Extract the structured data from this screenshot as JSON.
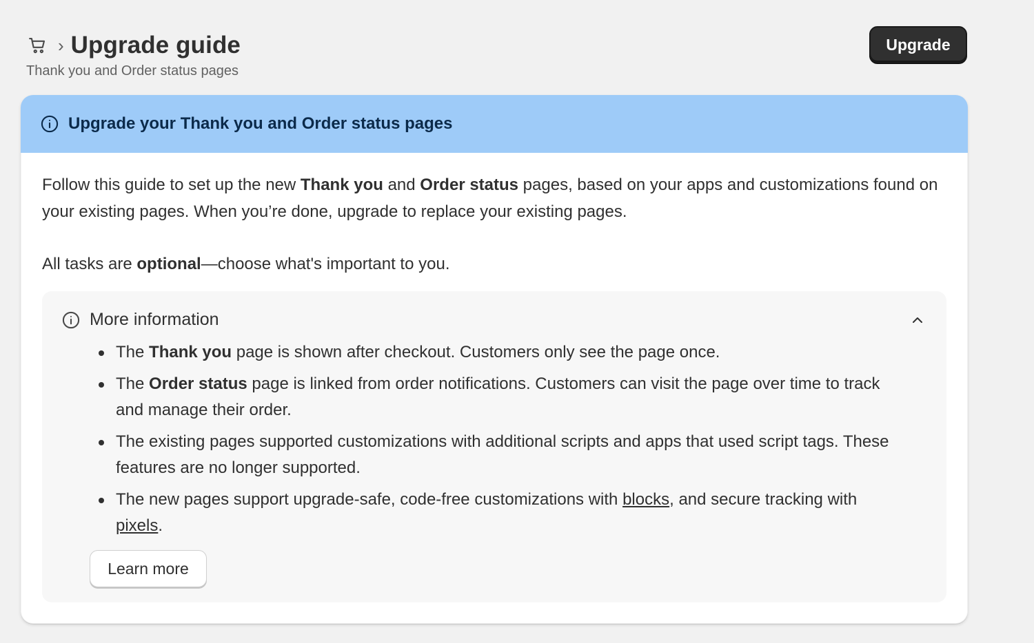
{
  "header": {
    "breadcrumb_separator": "›",
    "title": "Upgrade guide",
    "subtitle": "Thank you and Order status pages",
    "upgrade_label": "Upgrade",
    "icons": {
      "breadcrumb": "cart-icon"
    }
  },
  "banner": {
    "icon": "info-icon",
    "title": "Upgrade your Thank you and Order status pages",
    "color": "#9ecbf8"
  },
  "intro": {
    "p1_part1": "Follow this guide to set up the new ",
    "p1_bold1": "Thank you",
    "p1_part2": " and ",
    "p1_bold2": "Order status",
    "p1_part3": " pages, based on your apps and customizations found on your existing pages. When you’re done, upgrade to replace your existing pages.",
    "p2_part1": "All tasks are ",
    "p2_bold": "optional",
    "p2_part2": "—choose what's important to you."
  },
  "more_info": {
    "icon": "info-icon",
    "title": "More information",
    "toggle_icon": "chevron-up-icon",
    "bullets": [
      {
        "pre": "The ",
        "bold": "Thank you",
        "post": " page is shown after checkout. Customers only see the page once."
      },
      {
        "pre": "The ",
        "bold": "Order status",
        "post": " page is linked from order notifications. Customers can visit the page over time to track and manage their order."
      },
      {
        "text": "The existing pages supported customizations with additional scripts and apps that used script tags. These features are no longer supported."
      },
      {
        "pre": "The new pages support upgrade-safe, code-free customizations with ",
        "link1": "blocks",
        "mid": ", and secure tracking with ",
        "link2": "pixels",
        "post": "."
      }
    ],
    "learn_more_label": "Learn more"
  },
  "colors": {
    "page_bg": "#f1f1f1",
    "primary_button": "#303030",
    "banner_bg": "#9ecbf8",
    "banner_text": "#0b2a4a"
  }
}
